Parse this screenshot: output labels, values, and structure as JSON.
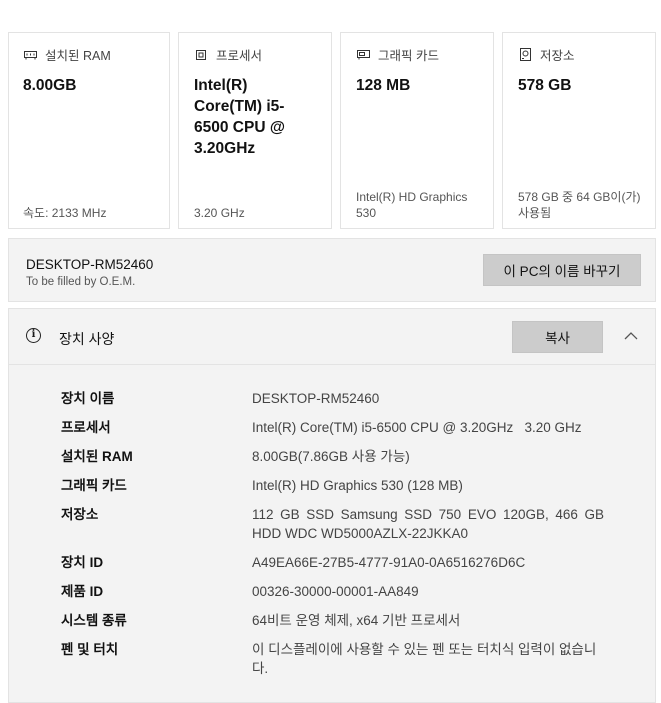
{
  "cards": [
    {
      "title": "설치된 RAM",
      "icon": "ram-icon",
      "value": "8.00GB",
      "footer": "속도: 2133 MHz"
    },
    {
      "title": "프로세서",
      "icon": "processor-icon",
      "value": "Intel(R) Core(TM) i5-6500 CPU @ 3.20GHz",
      "footer": "3.20 GHz"
    },
    {
      "title": "그래픽 카드",
      "icon": "graphics-card-icon",
      "value": "128 MB",
      "footer": "Intel(R) HD Graphics 530"
    },
    {
      "title": "저장소",
      "icon": "storage-icon",
      "value": "578 GB",
      "footer": "578 GB 중 64 GB이(가) 사용됨"
    }
  ],
  "pc": {
    "name": "DESKTOP-RM52460",
    "oem": "To be filled by O.E.M.",
    "rename_label": "이 PC의 이름 바꾸기"
  },
  "spec": {
    "title": "장치 사양",
    "copy_label": "복사",
    "rows": [
      {
        "label": "장치 이름",
        "value": "DESKTOP-RM52460"
      },
      {
        "label": "프로세서",
        "value": "Intel(R) Core(TM) i5-6500 CPU @ 3.20GHz   3.20 GHz"
      },
      {
        "label": "설치된 RAM",
        "value": "8.00GB(7.86GB 사용 가능)"
      },
      {
        "label": "그래픽 카드",
        "value": "Intel(R) HD Graphics 530 (128 MB)"
      },
      {
        "label": "저장소",
        "value": "112 GB SSD Samsung SSD 750 EVO 120GB, 466 GB HDD WDC WD5000AZLX-22JKKA0"
      },
      {
        "label": "장치 ID",
        "value": "A49EA66E-27B5-4777-91A0-0A6516276D6C"
      },
      {
        "label": "제품 ID",
        "value": "00326-30000-00001-AA849"
      },
      {
        "label": "시스템 종류",
        "value": "64비트 운영 체제, x64 기반 프로세서"
      },
      {
        "label": "펜 및 터치",
        "value": "이 디스플레이에 사용할 수 있는 펜 또는 터치식 입력이 없습니다."
      }
    ]
  }
}
